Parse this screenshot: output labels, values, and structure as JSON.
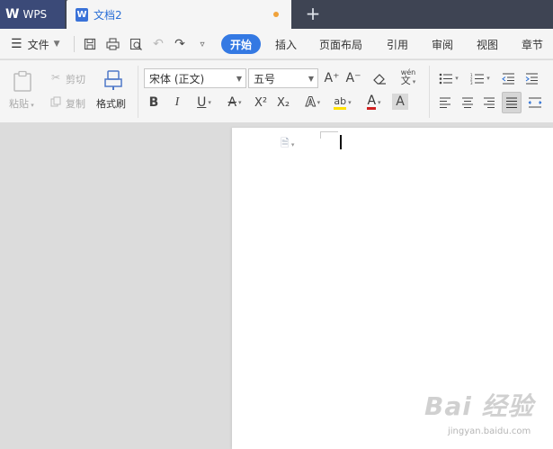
{
  "titlebar": {
    "app_tab": "WPS",
    "app_logo": "W",
    "doc_tab": "文档2",
    "doc_icon": "W",
    "new_tab": "+"
  },
  "menubar": {
    "file_label": "文件",
    "menu_icon": "☰",
    "items": [
      "开始",
      "插入",
      "页面布局",
      "引用",
      "审阅",
      "视图",
      "章节"
    ]
  },
  "ribbon": {
    "paste_label": "粘贴",
    "cut_label": "剪切",
    "copy_label": "复制",
    "format_painter_label": "格式刷",
    "font_name": "宋体 (正文)",
    "font_size": "五号",
    "bold": "B",
    "italic": "I",
    "underline": "U",
    "strikethrough": "A",
    "superscript": "X²",
    "subscript": "X₂",
    "text_effect": "A",
    "highlight": "ab",
    "font_color": "A",
    "char_shade": "A",
    "pinyin": "wén",
    "grow_font": "A⁺",
    "shrink_font": "A⁻"
  },
  "colors": {
    "accent": "#3479e3",
    "titlebar": "#3e4453",
    "unsaved_dot": "#f0a23a",
    "highlight": "#ffe100",
    "font_color": "#d02020"
  },
  "watermark": {
    "brand": "Bai 经验",
    "url": "jingyan.baidu.com"
  }
}
